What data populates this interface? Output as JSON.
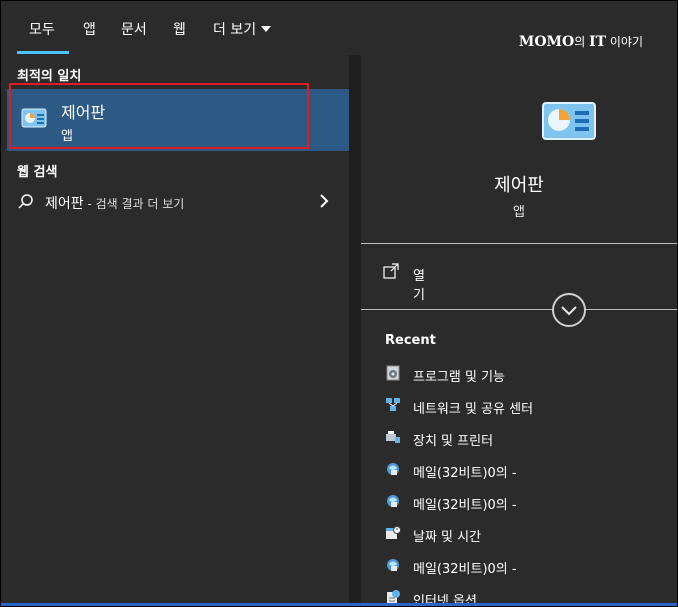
{
  "tabs": [
    {
      "label": "모두"
    },
    {
      "label": "앱"
    },
    {
      "label": "문서"
    },
    {
      "label": "웹"
    },
    {
      "label": "더 보기"
    }
  ],
  "brand": {
    "logo": "MOMO",
    "mid": "의 ",
    "it": "IT",
    "rest": " 이야기"
  },
  "best_match": {
    "section_label": "최적의 일치",
    "title": "제어판",
    "subtitle": "앱"
  },
  "web_search": {
    "section_label": "웹 검색",
    "query": "제어판",
    "suffix": " - 검색 결과 더 보기"
  },
  "detail": {
    "title": "제어판",
    "subtitle": "앱",
    "open_label": "열기",
    "recent_label": "Recent",
    "recent_items": [
      {
        "label": "프로그램 및 기능",
        "icon": "programs-features-icon"
      },
      {
        "label": "네트워크 및 공유 센터",
        "icon": "network-sharing-icon"
      },
      {
        "label": "장치 및 프린터",
        "icon": "devices-printers-icon"
      },
      {
        "label": "메일(32비트)0의 -",
        "icon": "mail-icon"
      },
      {
        "label": "메일(32비트)0의 -",
        "icon": "mail-icon"
      },
      {
        "label": "날짜 및 시간",
        "icon": "date-time-icon"
      },
      {
        "label": "메일(32비트)0의 -",
        "icon": "mail-icon"
      },
      {
        "label": "인터넷 옵션",
        "icon": "internet-options-icon"
      }
    ]
  },
  "colors": {
    "accent": "#4cc2ff",
    "selected": "#2d5a84",
    "highlight_border": "#e01b24",
    "background": "#2b2b2b"
  }
}
